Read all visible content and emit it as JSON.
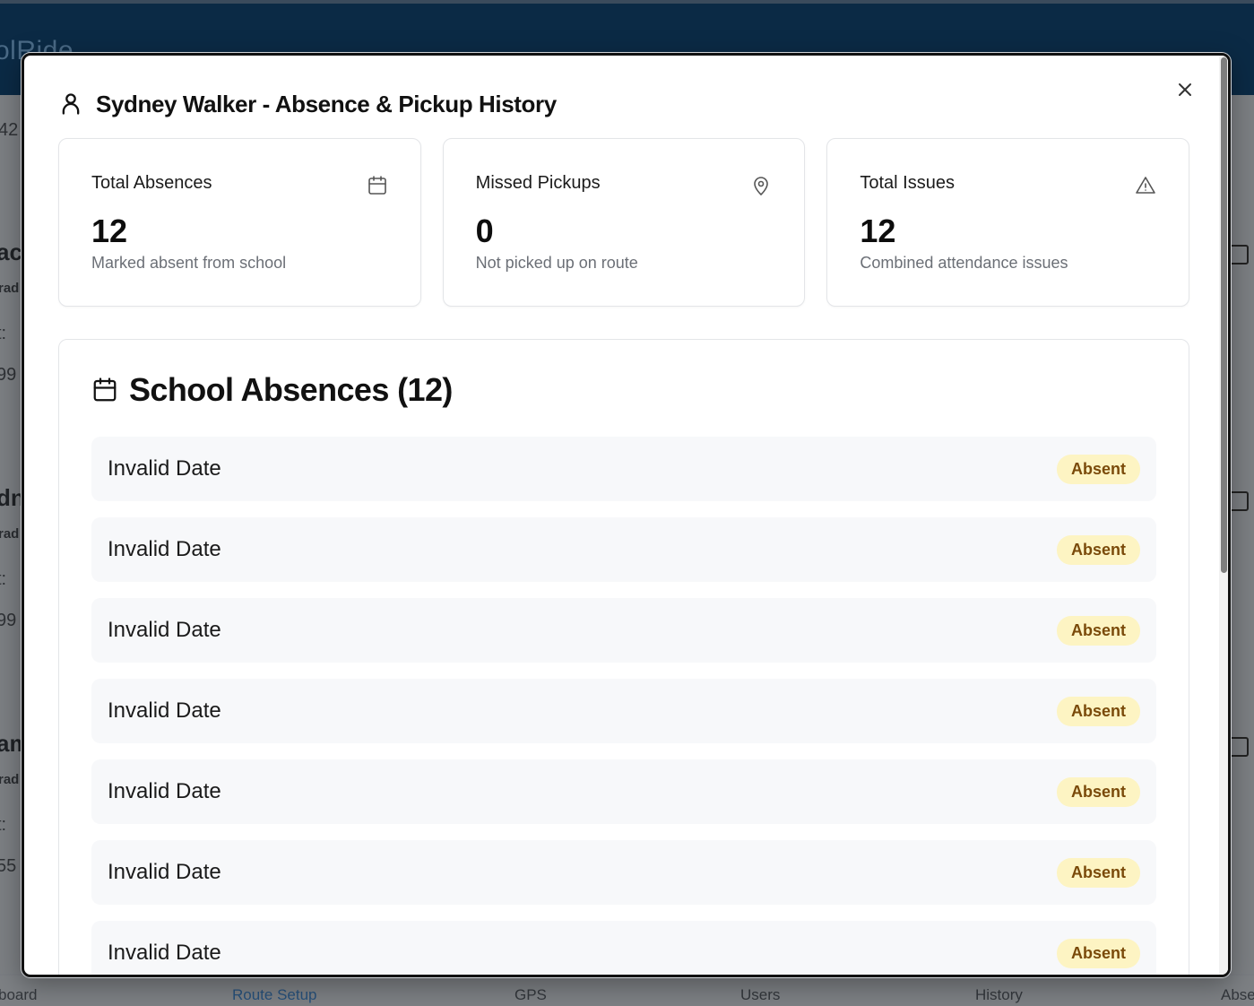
{
  "background": {
    "brand": "olRide",
    "fragments": [
      "42",
      "ac",
      "rad",
      "t:",
      "99",
      "dn",
      "rad",
      "t:",
      "99",
      "am",
      "rad",
      "t:",
      "55"
    ],
    "nav": [
      "board",
      "Route Setup",
      "GPS",
      "Users",
      "History",
      "Abse"
    ]
  },
  "modal": {
    "title": "Sydney Walker - Absence & Pickup History",
    "close_icon": "close-icon",
    "stats": [
      {
        "label": "Total Absences",
        "value": "12",
        "desc": "Marked absent from school",
        "icon": "calendar-icon"
      },
      {
        "label": "Missed Pickups",
        "value": "0",
        "desc": "Not picked up on route",
        "icon": "map-pin-icon"
      },
      {
        "label": "Total Issues",
        "value": "12",
        "desc": "Combined attendance issues",
        "icon": "alert-triangle-icon"
      }
    ],
    "section": {
      "title": "School Absences (12)",
      "icon": "calendar-icon"
    },
    "absences": [
      {
        "date": "Invalid Date",
        "status": "Absent"
      },
      {
        "date": "Invalid Date",
        "status": "Absent"
      },
      {
        "date": "Invalid Date",
        "status": "Absent"
      },
      {
        "date": "Invalid Date",
        "status": "Absent"
      },
      {
        "date": "Invalid Date",
        "status": "Absent"
      },
      {
        "date": "Invalid Date",
        "status": "Absent"
      },
      {
        "date": "Invalid Date",
        "status": "Absent"
      }
    ]
  },
  "colors": {
    "badge_bg": "#fdf4c3",
    "badge_text": "#7a4a0a",
    "topbar": "#0b2a45",
    "nav_active": "#27507a"
  }
}
